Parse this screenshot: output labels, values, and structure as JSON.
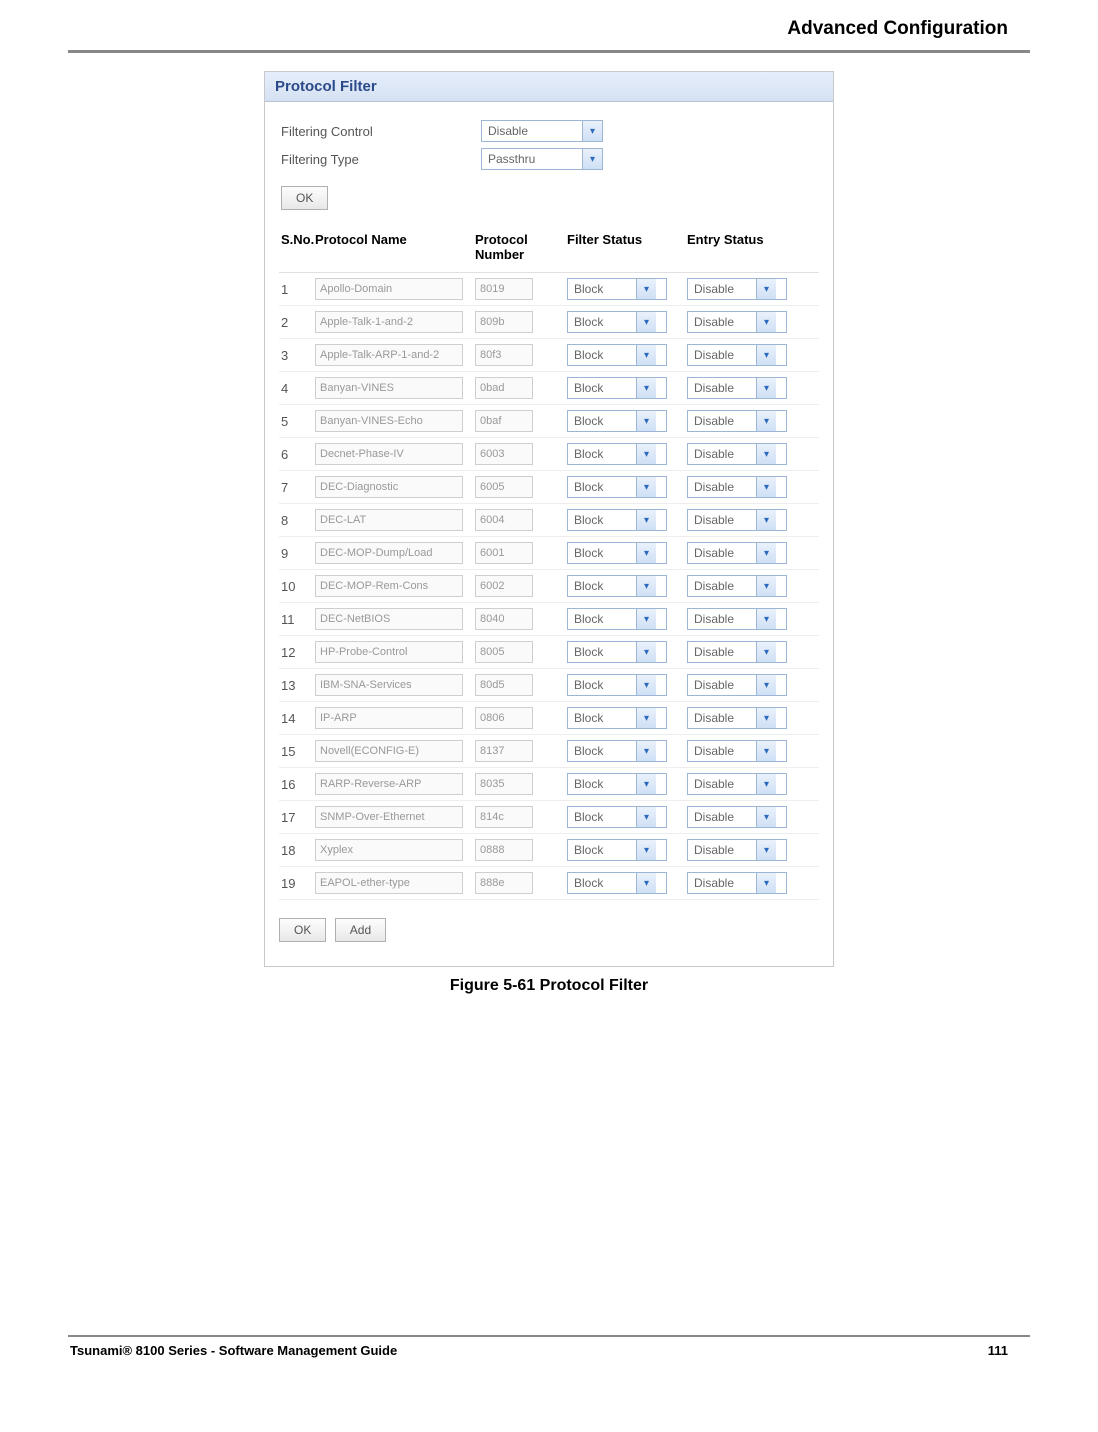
{
  "header": {
    "section": "Advanced Configuration"
  },
  "panel": {
    "title": "Protocol Filter",
    "filtering_control_label": "Filtering Control",
    "filtering_control_value": "Disable",
    "filtering_type_label": "Filtering Type",
    "filtering_type_value": "Passthru",
    "ok_label": "OK",
    "add_label": "Add"
  },
  "table": {
    "headers": {
      "sno": "S.No.",
      "name": "Protocol Name",
      "num": "Protocol Number",
      "fs": "Filter Status",
      "es": "Entry Status"
    },
    "rows": [
      {
        "sno": "1",
        "name": "Apollo-Domain",
        "num": "8019",
        "fs": "Block",
        "es": "Disable"
      },
      {
        "sno": "2",
        "name": "Apple-Talk-1-and-2",
        "num": "809b",
        "fs": "Block",
        "es": "Disable"
      },
      {
        "sno": "3",
        "name": "Apple-Talk-ARP-1-and-2",
        "num": "80f3",
        "fs": "Block",
        "es": "Disable"
      },
      {
        "sno": "4",
        "name": "Banyan-VINES",
        "num": "0bad",
        "fs": "Block",
        "es": "Disable"
      },
      {
        "sno": "5",
        "name": "Banyan-VINES-Echo",
        "num": "0baf",
        "fs": "Block",
        "es": "Disable"
      },
      {
        "sno": "6",
        "name": "Decnet-Phase-IV",
        "num": "6003",
        "fs": "Block",
        "es": "Disable"
      },
      {
        "sno": "7",
        "name": "DEC-Diagnostic",
        "num": "6005",
        "fs": "Block",
        "es": "Disable"
      },
      {
        "sno": "8",
        "name": "DEC-LAT",
        "num": "6004",
        "fs": "Block",
        "es": "Disable"
      },
      {
        "sno": "9",
        "name": "DEC-MOP-Dump/Load",
        "num": "6001",
        "fs": "Block",
        "es": "Disable"
      },
      {
        "sno": "10",
        "name": "DEC-MOP-Rem-Cons",
        "num": "6002",
        "fs": "Block",
        "es": "Disable"
      },
      {
        "sno": "11",
        "name": "DEC-NetBIOS",
        "num": "8040",
        "fs": "Block",
        "es": "Disable"
      },
      {
        "sno": "12",
        "name": "HP-Probe-Control",
        "num": "8005",
        "fs": "Block",
        "es": "Disable"
      },
      {
        "sno": "13",
        "name": "IBM-SNA-Services",
        "num": "80d5",
        "fs": "Block",
        "es": "Disable"
      },
      {
        "sno": "14",
        "name": "IP-ARP",
        "num": "0806",
        "fs": "Block",
        "es": "Disable"
      },
      {
        "sno": "15",
        "name": "Novell(ECONFIG-E)",
        "num": "8137",
        "fs": "Block",
        "es": "Disable"
      },
      {
        "sno": "16",
        "name": "RARP-Reverse-ARP",
        "num": "8035",
        "fs": "Block",
        "es": "Disable"
      },
      {
        "sno": "17",
        "name": "SNMP-Over-Ethernet",
        "num": "814c",
        "fs": "Block",
        "es": "Disable"
      },
      {
        "sno": "18",
        "name": "Xyplex",
        "num": "0888",
        "fs": "Block",
        "es": "Disable"
      },
      {
        "sno": "19",
        "name": "EAPOL-ether-type",
        "num": "888e",
        "fs": "Block",
        "es": "Disable"
      }
    ]
  },
  "caption": "Figure 5-61 Protocol Filter",
  "footer": {
    "left": "Tsunami® 8100 Series - Software Management Guide",
    "right": "111"
  }
}
